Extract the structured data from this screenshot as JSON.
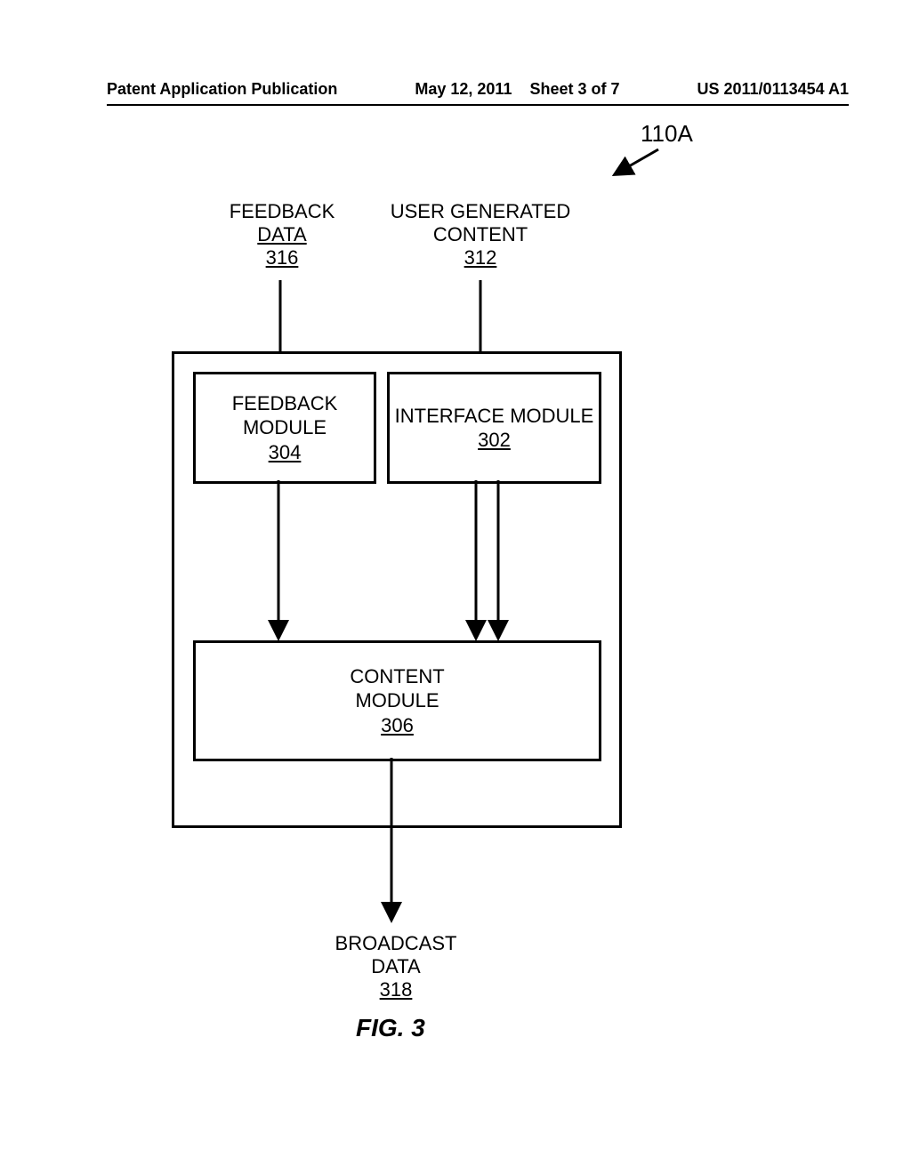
{
  "header": {
    "left": "Patent Application Publication",
    "middle_date": "May 12, 2011",
    "middle_sheet": "Sheet 3 of 7",
    "right": "US 2011/0113454 A1"
  },
  "ref110": "110A",
  "inputs": {
    "feedback_data": {
      "l1": "FEEDBACK",
      "l2": "DATA",
      "num": "316"
    },
    "user_content": {
      "l1": "USER GENERATED",
      "l2": "CONTENT",
      "num": "312"
    }
  },
  "boxes": {
    "feedback_module": {
      "l1": "FEEDBACK",
      "l2": "MODULE",
      "num": "304"
    },
    "interface_module": {
      "l1": "INTERFACE MODULE",
      "num": "302"
    },
    "content_module": {
      "l1": "CONTENT",
      "l2": "MODULE",
      "num": "306"
    }
  },
  "output": {
    "l1": "BROADCAST",
    "l2": "DATA",
    "num": "318"
  },
  "figure_label": "FIG. 3"
}
